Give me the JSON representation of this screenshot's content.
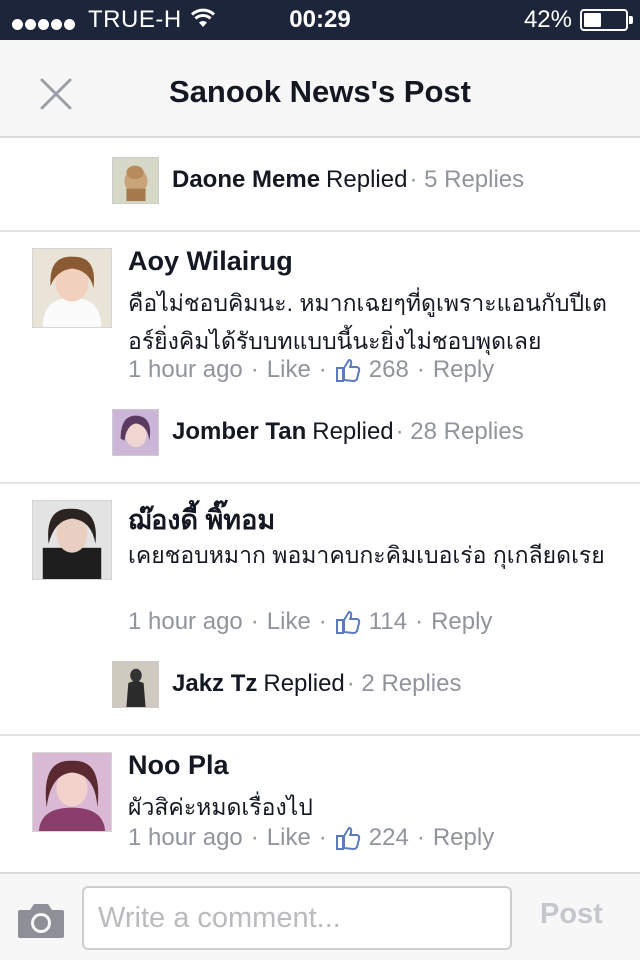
{
  "status_bar": {
    "carrier": "TRUE-H",
    "time": "00:29",
    "battery_percent": "42%",
    "battery_level": 0.42
  },
  "header": {
    "title": "Sanook News's Post"
  },
  "reply_summaries": [
    {
      "name": "Daone Meme",
      "verb": "Replied",
      "count": "· 5 Replies"
    },
    {
      "name": "Jomber Tan",
      "verb": "Replied",
      "count": "· 28 Replies"
    },
    {
      "name": "Jakz Tz",
      "verb": "Replied",
      "count": "· 2 Replies"
    }
  ],
  "comments": [
    {
      "author": "Aoy Wilairug",
      "text": "คือไม่ชอบคิมนะ. หมากเฉยๆที่ดูเพราะแอนกับปีเตอร์ยิ่งคิมได้รับบทแบบนี้นะยิ่งไม่ชอบพุดเลย",
      "time": "1 hour ago",
      "like": "Like",
      "likes": "268",
      "reply": "Reply"
    },
    {
      "author": "ฌ๊องดี้ พิ๊ทอม",
      "text": "เคยชอบหมาก พอมาคบกะคิมเบอเร่อ กุเกลียดเรย",
      "time": "1 hour ago",
      "like": "Like",
      "likes": "114",
      "reply": "Reply"
    },
    {
      "author": "Noo Pla",
      "text": "ผัวสิค่ะหมดเรื่องไป",
      "time": "1 hour ago",
      "like": "Like",
      "likes": "224",
      "reply": "Reply"
    }
  ],
  "composer": {
    "placeholder": "Write a comment...",
    "post_label": "Post"
  },
  "icons": {
    "signal": "signal-dots-icon",
    "wifi": "wifi-icon",
    "battery": "battery-icon",
    "close": "close-icon",
    "like": "thumbs-up-icon",
    "camera": "camera-icon"
  },
  "colors": {
    "status_bar_bg": "#1c2539",
    "meta_gray": "#90949c",
    "like_blue": "#5b7bc0",
    "post_disabled": "#c4c7cc"
  }
}
